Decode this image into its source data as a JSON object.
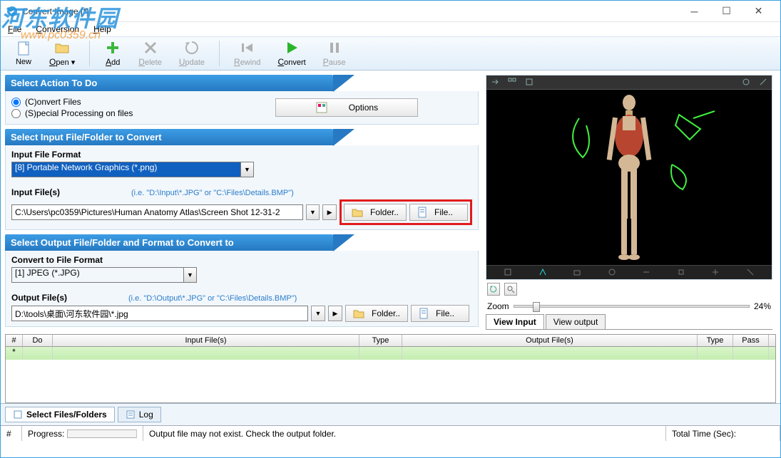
{
  "window": {
    "title": "Convert Image [*]"
  },
  "watermark": {
    "line1": "河东软件园",
    "line2": "www.pc0359.cn"
  },
  "menu": {
    "file": "File",
    "conversion": "Conversion",
    "help": "Help"
  },
  "toolbar": {
    "new": "New",
    "open": "Open",
    "add": "Add",
    "delete": "Delete",
    "update": "Update",
    "rewind": "Rewind",
    "convert": "Convert",
    "pause": "Pause"
  },
  "section1": {
    "title": "Select Action To Do",
    "radio_convert": "(C)onvert Files",
    "radio_special": "(S)pecial Processing on files",
    "options_btn": "Options"
  },
  "section2": {
    "title": "Select Input File/Folder to Convert",
    "format_label": "Input File Format",
    "format_value": "[8] Portable Network Graphics (*.png)",
    "files_label": "Input File(s)",
    "hint": "(i.e. \"D:\\Input\\*.JPG\" or \"C:\\Files\\Details.BMP\")",
    "path": "C:\\Users\\pc0359\\Pictures\\Human Anatomy Atlas\\Screen Shot 12-31-2",
    "folder_btn": "Folder..",
    "file_btn": "File.."
  },
  "section3": {
    "title": "Select Output File/Folder and Format to Convert to",
    "format_label": "Convert to File Format",
    "format_value": "[1] JPEG (*.JPG)",
    "files_label": "Output File(s)",
    "hint": "(i.e. \"D:\\Output\\*.JPG\" or \"C:\\Files\\Details.BMP\")",
    "path": "D:\\tools\\桌面\\河东软件园\\*.jpg",
    "folder_btn": "Folder..",
    "file_btn": "File.."
  },
  "zoom": {
    "label": "Zoom",
    "value": "24%"
  },
  "viewtabs": {
    "input": "View Input",
    "output": "View output"
  },
  "grid": {
    "col_num": "#",
    "col_do": "Do",
    "col_input": "Input File(s)",
    "col_type1": "Type",
    "col_output": "Output File(s)",
    "col_type2": "Type",
    "col_pass": "Pass",
    "star": "*"
  },
  "bottomtabs": {
    "select": "Select Files/Folders",
    "log": "Log"
  },
  "status": {
    "num": "#",
    "progress": "Progress:",
    "msg": "Output file may not exist. Check the output folder.",
    "total": "Total Time (Sec):"
  }
}
